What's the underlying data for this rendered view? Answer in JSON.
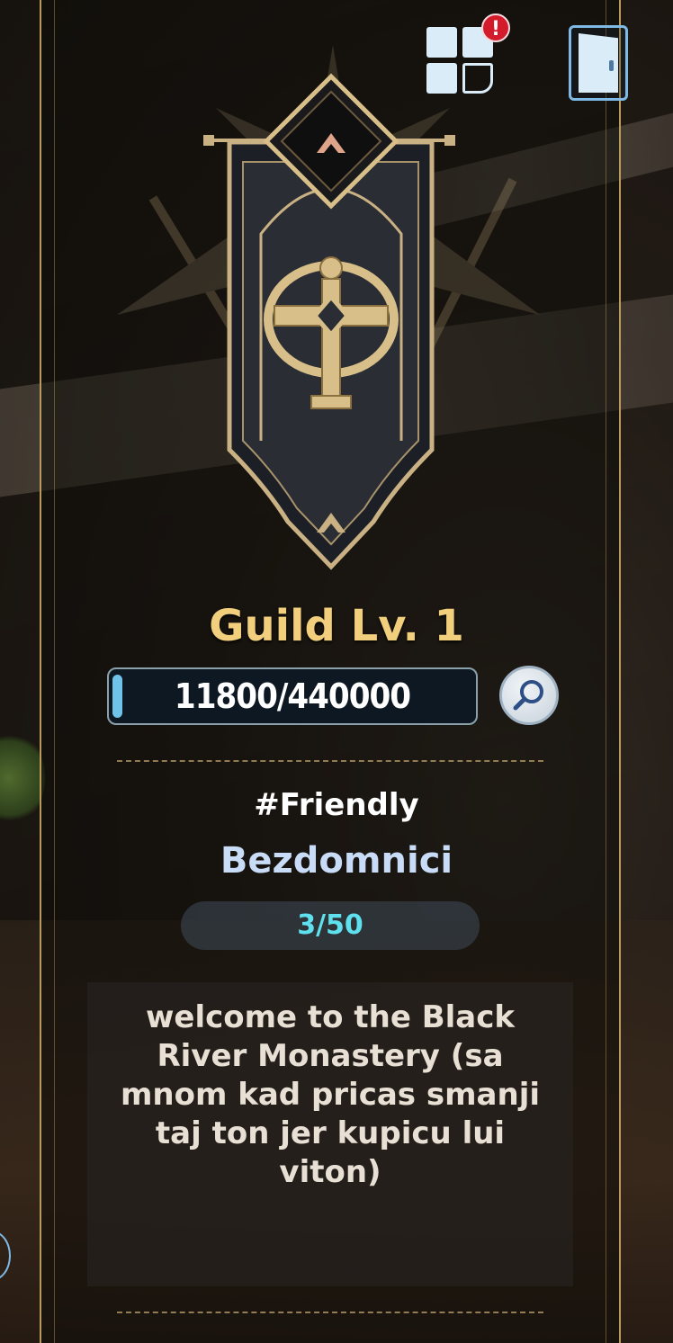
{
  "header": {
    "menu_icon": "grid-menu-icon",
    "alert_badge": "!",
    "exit_icon": "door-exit-icon"
  },
  "guild": {
    "level_label": "Guild Lv. 1",
    "xp_text": "11800/440000",
    "xp_current": 11800,
    "xp_max": 440000,
    "tag": "#Friendly",
    "name": "Bezdomnici",
    "members": "3/50",
    "description": "welcome to the Black River Monastery (sa mnom kad pricas smanji taj ton jer kupicu lui viton)"
  },
  "colors": {
    "level_text": "#f2cf7c",
    "guild_name": "#c9dcf7",
    "members_text": "#5fe0ee",
    "frame_gold": "#b89a5c",
    "alert_red": "#d31b2b"
  }
}
